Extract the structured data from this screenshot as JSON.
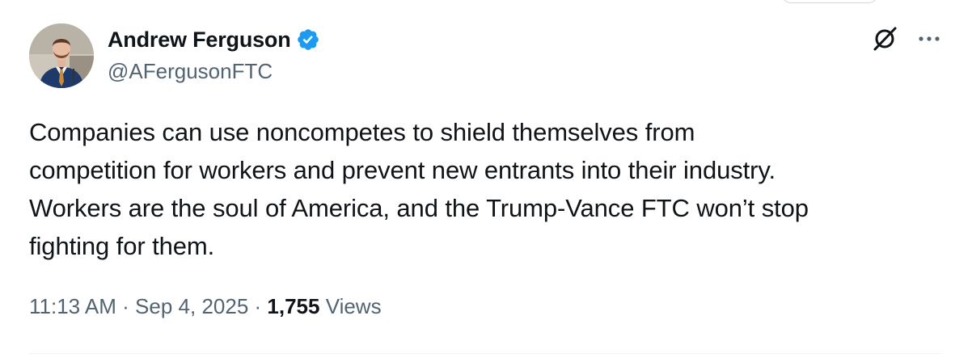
{
  "author": {
    "display_name": "Andrew Ferguson",
    "handle": "@AFergusonFTC",
    "verified": true,
    "verified_color": "#1d9bf0",
    "avatar_icon": "avatar-photo"
  },
  "header_actions": {
    "grok_icon": "grok-icon",
    "more_icon": "more-icon"
  },
  "tweet": {
    "text": "Companies can use noncompetes to shield themselves from\ncompetition for workers and prevent new entrants into their industry.\nWorkers are the soul of America, and the Trump-Vance FTC won’t stop\nfighting for them.",
    "time": "11:13 AM",
    "date": "Sep 4, 2025",
    "separator": " · ",
    "views_count": "1,755",
    "views_label": "Views"
  },
  "colors": {
    "text": "#0f1419",
    "secondary": "#536471",
    "divider": "#eff3f4"
  }
}
